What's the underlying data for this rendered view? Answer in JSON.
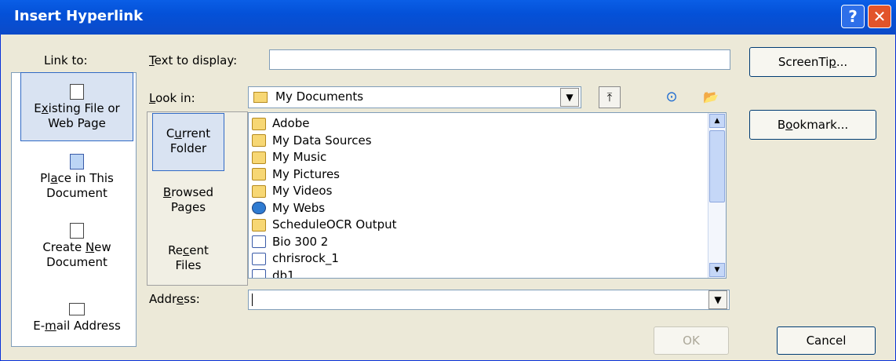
{
  "window": {
    "title": "Insert Hyperlink",
    "help": "?",
    "close": "✕"
  },
  "link_to": {
    "label": "Link to:",
    "items": [
      {
        "pre": "E",
        "u": "x",
        "post": "isting File or",
        "line2": "Web Page"
      },
      {
        "pre": "Pl",
        "u": "a",
        "post": "ce in This",
        "line2": "Document"
      },
      {
        "pre": "Create ",
        "u": "N",
        "post": "ew",
        "line2": "Document"
      },
      {
        "pre": "E-",
        "u": "m",
        "post": "ail Address",
        "line2": ""
      }
    ]
  },
  "text_display": {
    "u": "T",
    "rest": "ext to display:",
    "value": ""
  },
  "screentip": {
    "pre": "ScreenTi",
    "u": "p",
    "post": "..."
  },
  "look_in": {
    "u": "L",
    "rest": "ook in:",
    "value": "My Documents"
  },
  "bookmark": {
    "pre": "B",
    "u": "o",
    "post": "okmark..."
  },
  "nav": [
    {
      "pre": "C",
      "u": "u",
      "post": "rrent",
      "line2": "Folder"
    },
    {
      "pre": "",
      "u": "B",
      "post": "rowsed",
      "line2": "Pages"
    },
    {
      "pre": "Re",
      "u": "c",
      "post": "ent",
      "line2": "Files"
    }
  ],
  "files": [
    {
      "name": "Adobe",
      "icon": "folder"
    },
    {
      "name": "My Data Sources",
      "icon": "folder"
    },
    {
      "name": "My Music",
      "icon": "folder"
    },
    {
      "name": "My Pictures",
      "icon": "folder"
    },
    {
      "name": "My Videos",
      "icon": "folder"
    },
    {
      "name": "My Webs",
      "icon": "globe"
    },
    {
      "name": "ScheduleOCR Output",
      "icon": "folder"
    },
    {
      "name": "Bio 300 2",
      "icon": "doc"
    },
    {
      "name": "chrisrock_1",
      "icon": "doc"
    },
    {
      "name": "db1",
      "icon": "doc"
    }
  ],
  "address": {
    "pre": "Addr",
    "u": "e",
    "post": "ss:",
    "value": ""
  },
  "ok": "OK",
  "cancel": "Cancel"
}
